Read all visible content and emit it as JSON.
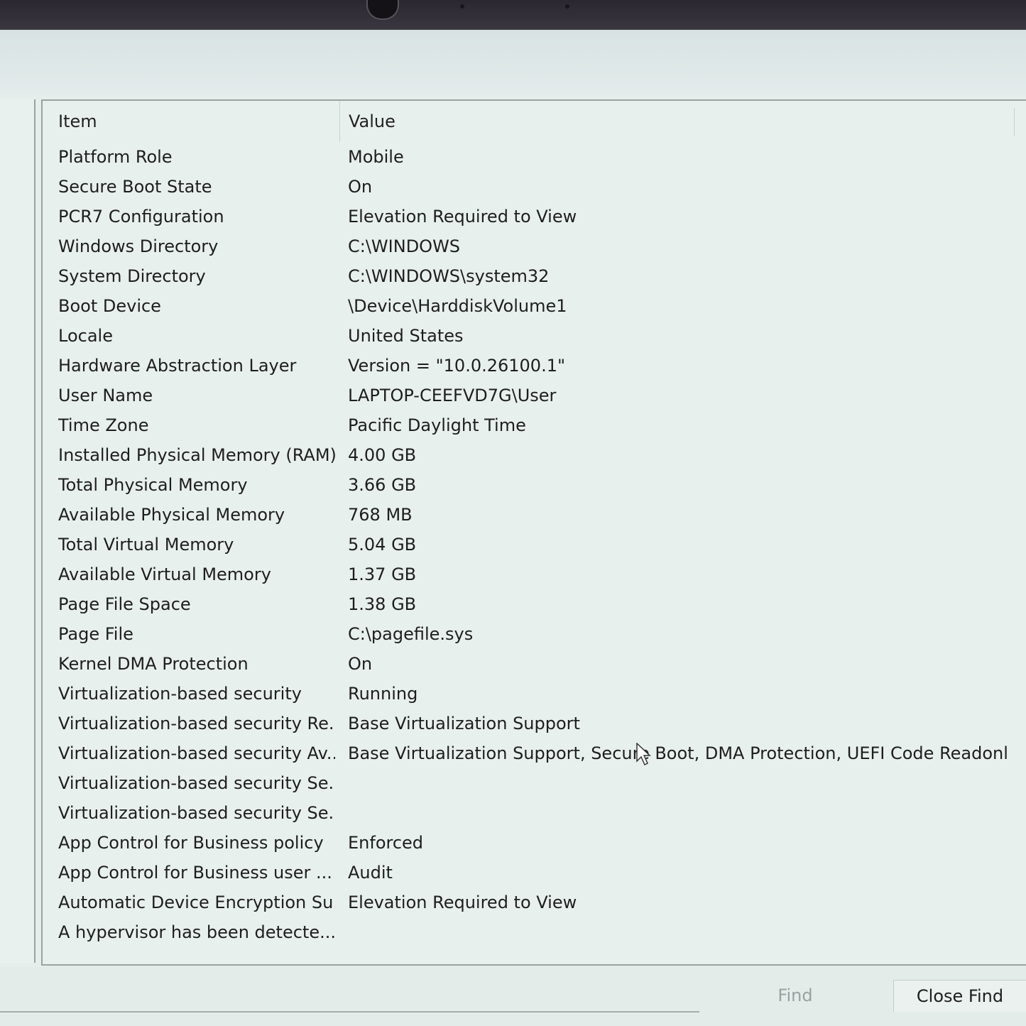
{
  "list": {
    "columns": {
      "item": "Item",
      "value": "Value"
    },
    "rows": [
      {
        "item": "Platform Role",
        "value": "Mobile"
      },
      {
        "item": "Secure Boot State",
        "value": "On"
      },
      {
        "item": "PCR7 Configuration",
        "value": "Elevation Required to View"
      },
      {
        "item": "Windows Directory",
        "value": "C:\\WINDOWS"
      },
      {
        "item": "System Directory",
        "value": "C:\\WINDOWS\\system32"
      },
      {
        "item": "Boot Device",
        "value": "\\Device\\HarddiskVolume1"
      },
      {
        "item": "Locale",
        "value": "United States"
      },
      {
        "item": "Hardware Abstraction Layer",
        "value": "Version = \"10.0.26100.1\""
      },
      {
        "item": "User Name",
        "value": "LAPTOP-CEEFVD7G\\User"
      },
      {
        "item": "Time Zone",
        "value": "Pacific Daylight Time"
      },
      {
        "item": "Installed Physical Memory (RAM)",
        "value": "4.00 GB"
      },
      {
        "item": "Total Physical Memory",
        "value": "3.66 GB"
      },
      {
        "item": "Available Physical Memory",
        "value": "768 MB"
      },
      {
        "item": "Total Virtual Memory",
        "value": "5.04 GB"
      },
      {
        "item": "Available Virtual Memory",
        "value": "1.37 GB"
      },
      {
        "item": "Page File Space",
        "value": "1.38 GB"
      },
      {
        "item": "Page File",
        "value": "C:\\pagefile.sys"
      },
      {
        "item": "Kernel DMA Protection",
        "value": "On"
      },
      {
        "item": "Virtualization-based security",
        "value": "Running"
      },
      {
        "item": "Virtualization-based security Re...",
        "value": "Base Virtualization Support"
      },
      {
        "item": "Virtualization-based security Av...",
        "value": "Base Virtualization Support, Secure Boot, DMA Protection, UEFI Code Readonl..."
      },
      {
        "item": "Virtualization-based security Se...",
        "value": ""
      },
      {
        "item": "Virtualization-based security Se...",
        "value": ""
      },
      {
        "item": "App Control for Business policy",
        "value": "Enforced"
      },
      {
        "item": "App Control for Business user ...",
        "value": "Audit"
      },
      {
        "item": "Automatic Device Encryption Su...",
        "value": "Elevation Required to View"
      },
      {
        "item": "A hypervisor has been detecte...",
        "value": ""
      }
    ]
  },
  "footer": {
    "find_label": "Find",
    "close_find_label": "Close Find"
  }
}
